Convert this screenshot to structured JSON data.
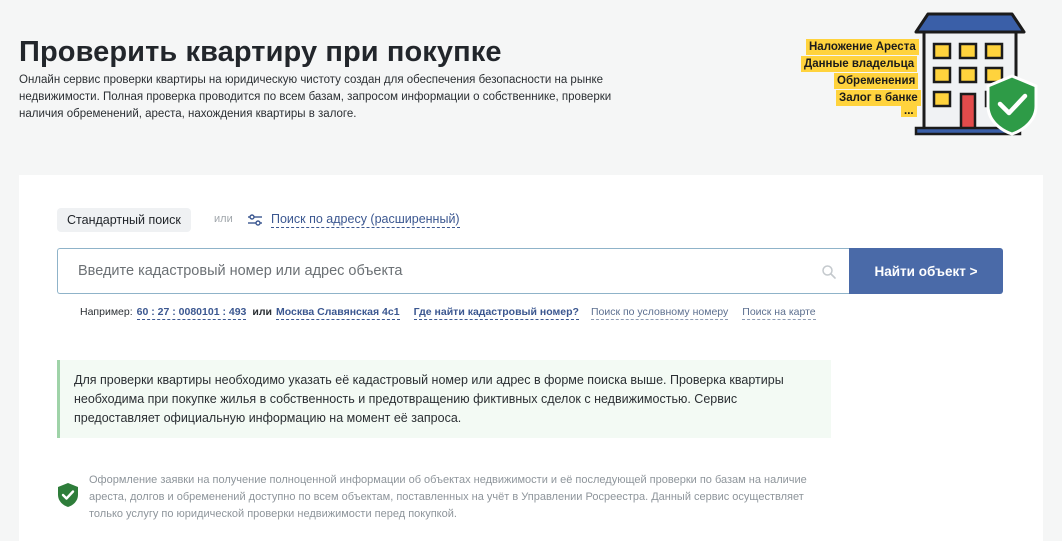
{
  "header": {
    "title": "Проверить квартиру при покупке",
    "description": "Онлайн сервис проверки квартиры на юридическую чистоту создан для обеспечения безопасности на рынке недвижимости. Полная проверка проводится по всем базам, запросом информации о собственнике, проверки наличия обременений, ареста, нахождения квартиры в залоге."
  },
  "illustration": {
    "tags": [
      "Наложение Ареста",
      "Данные владельца",
      "Обременения",
      "Залог в банке",
      "..."
    ],
    "icon": "apartment-building-with-shield",
    "colors": {
      "tag": "#ffd33d",
      "building": "#3a5fa8",
      "shield": "#2e9b47"
    }
  },
  "search": {
    "mode_standard": "Стандартный поиск",
    "mode_or": "или",
    "mode_advanced": "Поиск по адресу (расширенный)",
    "placeholder": "Введите кадастровый номер или адрес объекта",
    "value": "",
    "submit_label": "Найти объект >"
  },
  "examples": {
    "prefix": "Например:",
    "cadastral_example": "60 : 27 : 0080101 : 493",
    "or": "или",
    "address_example": "Москва Славянская 4с1",
    "where_link": "Где найти кадастровый номер?",
    "conditional_link": "Поиск по условному номеру",
    "map_link": "Поиск на карте"
  },
  "info": {
    "text": "Для проверки квартиры необходимо указать её кадастровый номер или адрес в форме поиска выше. Проверка квартиры необходима при покупке жилья в собственность и предотвращению фиктивных сделок с недвижимостью. Сервис предоставляет официальную информацию на момент её запроса."
  },
  "disclaimer": {
    "text": "Оформление заявки на получение полноценной информации об объектах недвижимости и её последующей проверки по базам на наличие ареста, долгов и обременений доступно по всем объектам, поставленных на учёт в Управлении Росреестра. Данный сервис осуществляет только услугу по юридической проверки недвижимости перед покупкой."
  },
  "colors": {
    "accent": "#4a6aa8",
    "link": "#3b5790",
    "info_bg": "#f3faf4",
    "info_border": "#9fd3a8"
  }
}
